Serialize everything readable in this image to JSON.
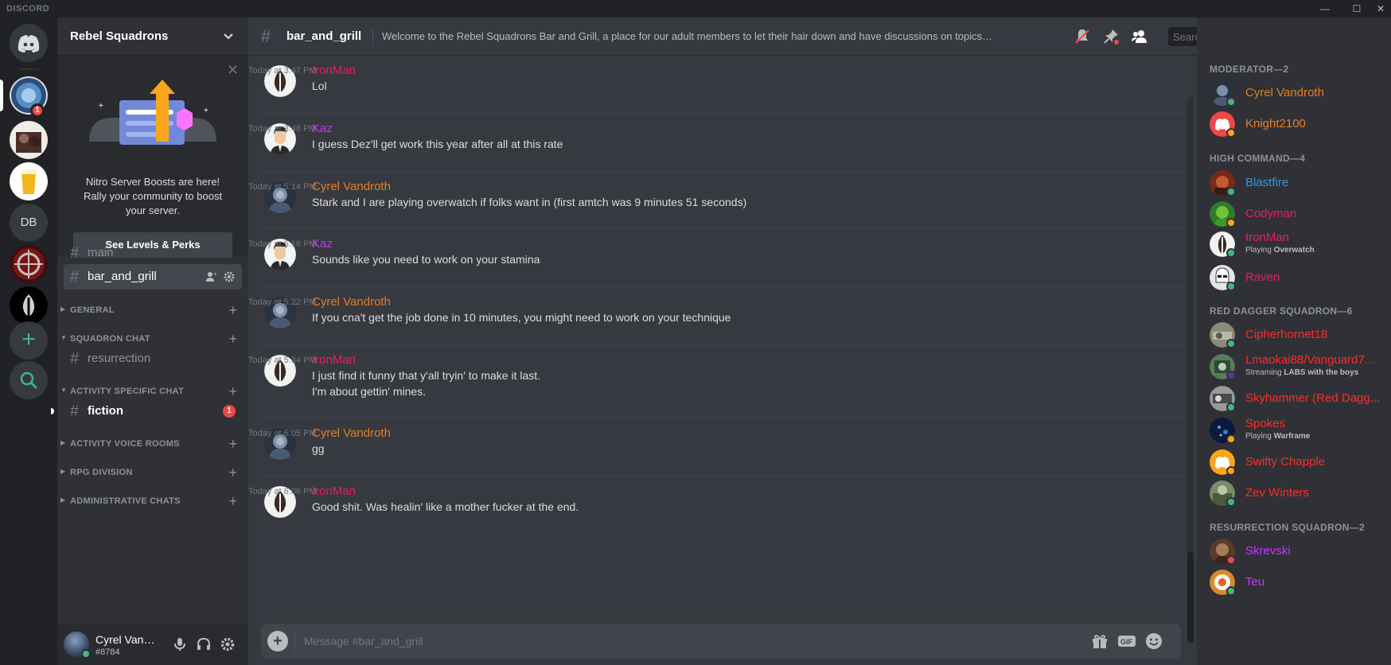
{
  "titlebar": {
    "brand": "DISCORD",
    "minimize": "—",
    "maximize": "☐",
    "close": "✕"
  },
  "servers": {
    "home_icon": "discord-logo-icon",
    "items": [
      {
        "name": "rebel-squadrons-server",
        "badge": "1",
        "active": true
      },
      {
        "name": "server-2"
      },
      {
        "name": "beer-server"
      },
      {
        "name": "db-server",
        "initials": "DB"
      },
      {
        "name": "red-emblem-server"
      },
      {
        "name": "rebel-alliance-server"
      }
    ],
    "add_icon": "plus-icon",
    "discover_icon": "search-icon"
  },
  "sidebar": {
    "server_name": "Rebel Squadrons",
    "boost": {
      "text_line1": "Nitro Server Boosts are here!",
      "text_line2": "Rally your community to boost",
      "text_line3": "your server.",
      "button": "See Levels & Perks"
    },
    "channels": {
      "main": "main",
      "bar_and_grill": "bar_and_grill",
      "resurrection": "resurrection",
      "fiction": "fiction",
      "fiction_mentions": "1"
    },
    "categories": {
      "general": "GENERAL",
      "squadron_chat": "SQUADRON CHAT",
      "activity_specific": "ACTIVITY SPECIFIC CHAT",
      "activity_voice": "ACTIVITY VOICE ROOMS",
      "rpg": "RPG DIVISION",
      "administrative": "ADMINISTRATIVE CHATS"
    },
    "user": {
      "name": "Cyrel Vandroth",
      "tag": "#8784"
    }
  },
  "chat": {
    "channel_name": "bar_and_grill",
    "topic": "Welcome to the Rebel Squadrons Bar and Grill, a place for our adult members to let their hair down and have discussions on topics not neccessarily appropriate elsewhere.",
    "search_placeholder": "Search",
    "composer_placeholder": "Message #bar_and_grill",
    "messages": [
      {
        "author": "IronMan",
        "color": "#e91e63",
        "time": "Today at 3:47 PM",
        "lines": [
          "Lol"
        ]
      },
      {
        "author": "Kaz",
        "color": "#cc33ff",
        "time": "Today at 3:48 PM",
        "lines": [
          "I guess Dez'll get work this year after all at this rate"
        ]
      },
      {
        "author": "Cyrel Vandroth",
        "color": "#e67e22",
        "time": "Today at 5:14 PM",
        "lines": [
          "Stark and I are playing overwatch if folks want in (first amtch was 9 minutes 51 seconds)"
        ]
      },
      {
        "author": "Kaz",
        "color": "#cc33ff",
        "time": "Today at 5:16 PM",
        "lines": [
          "Sounds like you need to work on your stamina"
        ]
      },
      {
        "author": "Cyrel Vandroth",
        "color": "#e67e22",
        "time": "Today at 5:22 PM",
        "lines": [
          "If you cna't get the job done in 10 minutes, you might need to work on your technique"
        ]
      },
      {
        "author": "IronMan",
        "color": "#e91e63",
        "time": "Today at 5:34 PM",
        "lines": [
          "I just find it funny that y'all tryin' to make it last.",
          "I'm about gettin' mines."
        ]
      },
      {
        "author": "Cyrel Vandroth",
        "color": "#e67e22",
        "time": "Today at 6:05 PM",
        "lines": [
          "gg"
        ]
      },
      {
        "author": "IronMan",
        "color": "#e91e63",
        "time": "Today at 6:06 PM",
        "lines": [
          "Good shit.  Was healin' like a mother fucker at the end."
        ]
      }
    ]
  },
  "members": {
    "groups": [
      {
        "title": "MODERATOR—2",
        "members": [
          {
            "name": "Cyrel Vandroth",
            "color": "#e67e22",
            "status": "#43b581",
            "avatar": "cyrel"
          },
          {
            "name": "Knight2100",
            "color": "#e67e22",
            "status": "#faa61a",
            "avatar": "discord-red"
          }
        ]
      },
      {
        "title": "HIGH COMMAND—4",
        "members": [
          {
            "name": "Blastfire",
            "color": "#3498db",
            "status": "#43b581",
            "avatar": "blastfire"
          },
          {
            "name": "Codyman",
            "color": "#e91e63",
            "status": "#faa61a",
            "avatar": "codyman"
          },
          {
            "name": "IronMan",
            "color": "#e91e63",
            "status": "#43b581",
            "avatar": "rebel",
            "activity_prefix": "Playing ",
            "activity": "Overwatch"
          },
          {
            "name": "Raven",
            "color": "#e91e63",
            "status": "#43b581",
            "avatar": "trooper"
          }
        ]
      },
      {
        "title": "RED DAGGER SQUADRON—6",
        "members": [
          {
            "name": "Cipherhornet18",
            "color": "#ff2a2a",
            "status": "#43b581",
            "avatar": "cipher"
          },
          {
            "name": "Lmaokai88/Vanguard7...",
            "color": "#ff2a2a",
            "status": "#593695",
            "avatar": "lmao",
            "activity_prefix": "Streaming ",
            "activity": "LABS with the boys"
          },
          {
            "name": "Skyhammer (Red Dagg...",
            "color": "#ff2a2a",
            "status": "#43b581",
            "avatar": "sky"
          },
          {
            "name": "Spokes",
            "color": "#ff2a2a",
            "status": "#faa61a",
            "avatar": "spokes",
            "activity_prefix": "Playing ",
            "activity": "Warframe"
          },
          {
            "name": "Swifty Chapple",
            "color": "#ff2a2a",
            "status": "#faa61a",
            "avatar": "discord-yellow"
          },
          {
            "name": "Zev Winters",
            "color": "#ff2a2a",
            "status": "#43b581",
            "avatar": "zev"
          }
        ]
      },
      {
        "title": "RESURRECTION SQUADRON—2",
        "members": [
          {
            "name": "Skrevski",
            "color": "#cc33ff",
            "status": "#f04747",
            "avatar": "skrev"
          },
          {
            "name": "Teu",
            "color": "#cc33ff",
            "status": "#43b581",
            "avatar": "teu"
          }
        ]
      }
    ]
  }
}
